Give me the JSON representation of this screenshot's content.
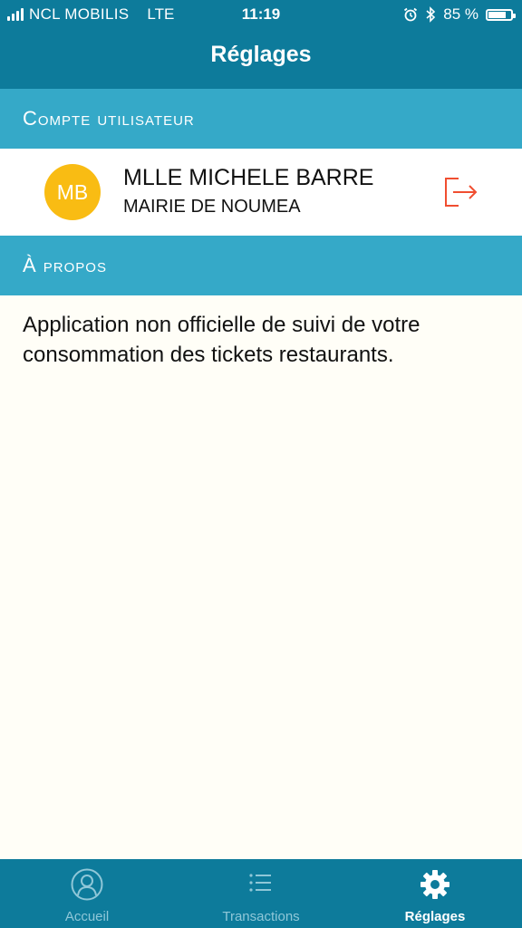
{
  "status_bar": {
    "carrier": "NCL MOBILIS",
    "network": "LTE",
    "time": "11:19",
    "battery": "85 %",
    "battery_level": 0.85
  },
  "nav": {
    "title": "Réglages"
  },
  "account_section": {
    "header": "Compte utilisateur",
    "user": {
      "initials": "MB",
      "name": "MLLE MICHELE BARRE",
      "organization": "MAIRIE DE NOUMEA"
    },
    "avatar_color": "#f9bc13",
    "logout_icon": "logout-icon"
  },
  "about_section": {
    "header": "À propos",
    "text": "Application non officielle de suivi de votre consommation des tickets restaurants."
  },
  "tab_bar": {
    "tabs": [
      {
        "label": "Accueil",
        "icon": "user-icon",
        "active": false
      },
      {
        "label": "Transactions",
        "icon": "list-icon",
        "active": false
      },
      {
        "label": "Réglages",
        "icon": "gear-icon",
        "active": true
      }
    ]
  },
  "colors": {
    "primary": "#0d7b9b",
    "section_header": "#35a9c8",
    "logout": "#f04e30",
    "background": "#fffef7"
  }
}
